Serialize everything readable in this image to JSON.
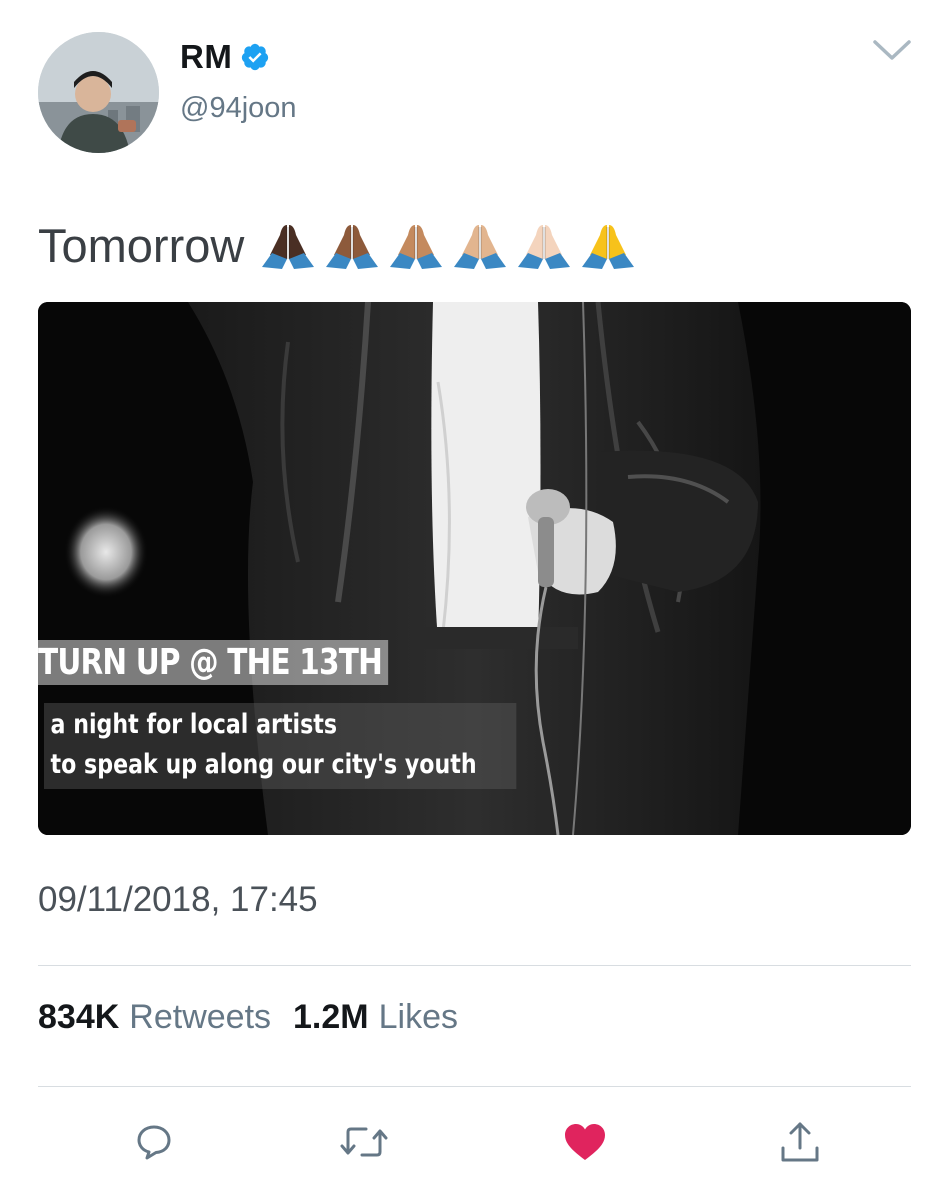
{
  "author": {
    "display_name": "RM",
    "handle": "@94joon",
    "verified_icon": "verified-badge-icon"
  },
  "tweet": {
    "text": "Tomorrow",
    "emoji": [
      "folded-hands-dark",
      "folded-hands-medium-dark",
      "folded-hands-medium",
      "folded-hands-medium-light",
      "folded-hands-light",
      "folded-hands-default"
    ],
    "media": {
      "title": "TURN UP @ THE 13TH",
      "subtitle_line1": "a night for local artists",
      "subtitle_line2": "to speak up along our city's youth"
    },
    "timestamp": "09/11/2018, 17:45"
  },
  "stats": {
    "retweets_count": "834K",
    "retweets_label": "Retweets",
    "likes_count": "1.2M",
    "likes_label": "Likes"
  },
  "actions": [
    "reply-icon",
    "retweet-icon",
    "like-icon",
    "share-icon"
  ],
  "colors": {
    "verified": "#1da1f2",
    "like_active": "#e0245e",
    "icon_gray": "#657786",
    "text_secondary": "#657786"
  }
}
